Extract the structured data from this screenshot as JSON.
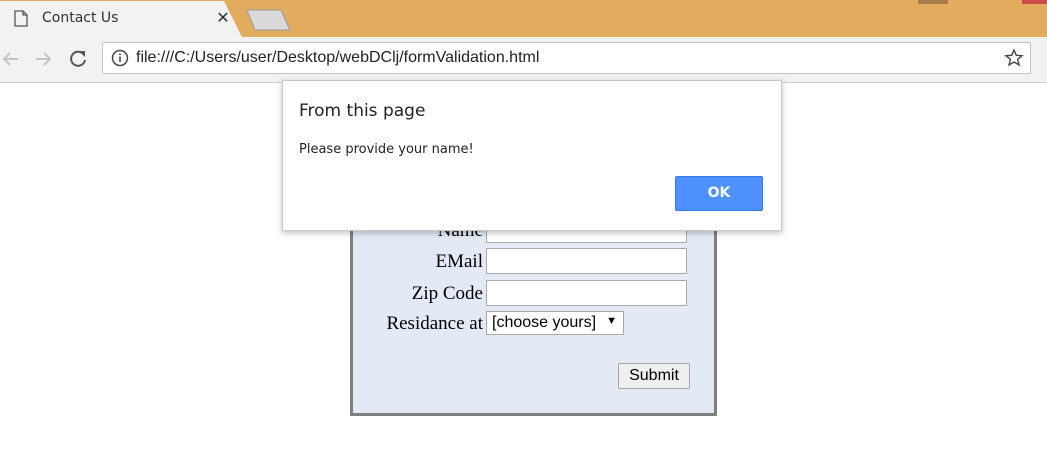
{
  "browser": {
    "tab_title": "Contact Us",
    "tab_close": "✕",
    "url": "file:///C:/Users/user/Desktop/webDClj/formValidation.html"
  },
  "form": {
    "name_label": "Name",
    "email_label": "EMail",
    "zip_label": "Zip Code",
    "residence_label": "Residance at",
    "residence_selected": "[choose yours]",
    "submit_label": "Submit",
    "name_value": "",
    "email_value": "",
    "zip_value": ""
  },
  "dialog": {
    "title": "From this page",
    "message": "Please provide your name!",
    "ok_label": "OK"
  },
  "colors": {
    "tabstrip": "#e2ab5e",
    "form_background": "#e3eaf5",
    "ok_button": "#4d90fe"
  }
}
